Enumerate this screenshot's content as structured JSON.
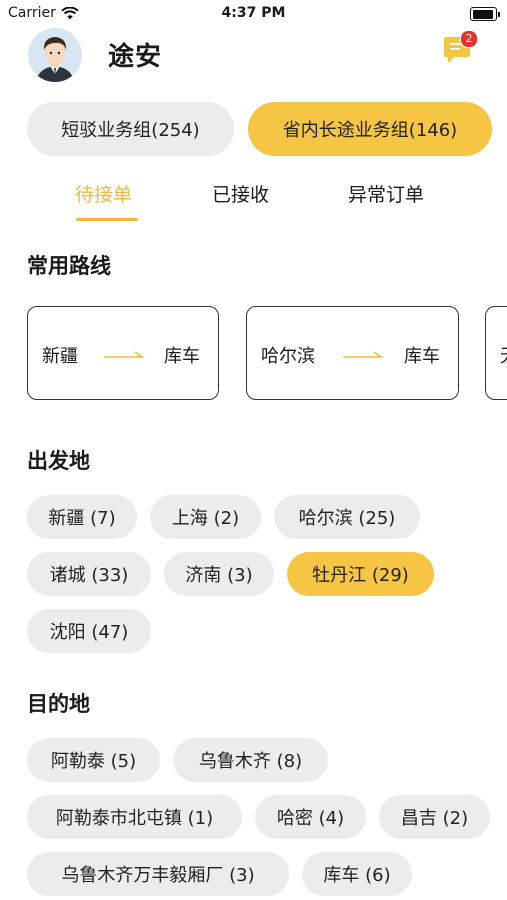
{
  "status_bar": {
    "carrier": "Carrier",
    "time": "4:37 PM"
  },
  "header": {
    "user_name": "途安",
    "message_badge": "2"
  },
  "groups": [
    {
      "label": "短驳业务组(254)",
      "selected": false
    },
    {
      "label": "省内长途业务组(146)",
      "selected": true
    }
  ],
  "tabs": [
    {
      "label": "待接单",
      "active": true
    },
    {
      "label": "已接收",
      "active": false
    },
    {
      "label": "异常订单",
      "active": false
    }
  ],
  "routes_section": {
    "title": "常用路线",
    "routes": [
      {
        "from": "新疆",
        "to": "库车"
      },
      {
        "from": "哈尔滨",
        "to": "库车"
      },
      {
        "from": "无",
        "to": ""
      }
    ]
  },
  "origin_section": {
    "title": "出发地",
    "items": [
      {
        "label": "新疆 (7)",
        "selected": false
      },
      {
        "label": "上海 (2)",
        "selected": false
      },
      {
        "label": "哈尔滨 (25)",
        "selected": false
      },
      {
        "label": "诸城 (33)",
        "selected": false
      },
      {
        "label": "济南 (3)",
        "selected": false
      },
      {
        "label": "牡丹江 (29)",
        "selected": true
      },
      {
        "label": "沈阳 (47)",
        "selected": false
      }
    ]
  },
  "destination_section": {
    "title": "目的地",
    "items": [
      {
        "label": "阿勒泰 (5)",
        "selected": false
      },
      {
        "label": "乌鲁木齐 (8)",
        "selected": false
      },
      {
        "label": "阿勒泰市北屯镇 (1)",
        "selected": false
      },
      {
        "label": "哈密 (4)",
        "selected": false
      },
      {
        "label": "昌吉 (2)",
        "selected": false
      },
      {
        "label": "乌鲁木齐万丰毅厢厂 (3)",
        "selected": false
      },
      {
        "label": "库车 (6)",
        "selected": false
      }
    ]
  },
  "colors": {
    "accent": "#f6c544",
    "tab_active": "#f0b93a",
    "chip_bg": "#ececec",
    "badge": "#e5322d"
  }
}
